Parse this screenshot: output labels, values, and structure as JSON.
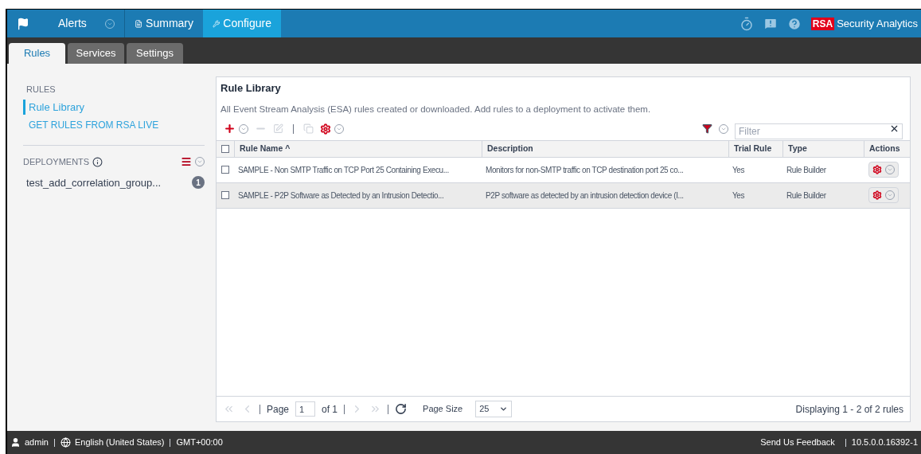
{
  "top_nav": {
    "items": [
      {
        "kind": "flag",
        "selected": false
      },
      {
        "kind": "dropdown",
        "label": "Alerts",
        "selected": false
      },
      {
        "kind": "summary",
        "label": "Summary",
        "selected": false
      },
      {
        "kind": "configure",
        "label": "Configure",
        "selected": true
      }
    ],
    "brand": {
      "logo": "RSA",
      "name": "Security Analytics"
    }
  },
  "sub_tabs": [
    {
      "label": "Rules",
      "selected": true
    },
    {
      "label": "Services",
      "selected": false
    },
    {
      "label": "Settings",
      "selected": false
    }
  ],
  "sidebar": {
    "heading": "RULES",
    "items": [
      {
        "label": "Rule Library",
        "selected": true
      },
      {
        "label": "GET RULES FROM RSA LIVE",
        "selected": false
      }
    ],
    "deployments": {
      "heading": "DEPLOYMENTS",
      "items": [
        {
          "name": "test_add_correlation_group...",
          "count": "1"
        }
      ]
    }
  },
  "panel": {
    "title": "Rule Library",
    "description": "All Event Stream Analysis (ESA) rules created or downloaded. Add rules to a deployment to activate them.",
    "toolbar": [
      {
        "kind": "add",
        "disabled": false
      },
      {
        "kind": "remove",
        "disabled": true
      },
      {
        "kind": "edit",
        "disabled": true
      },
      {
        "kind": "separator"
      },
      {
        "kind": "copy",
        "disabled": true
      },
      {
        "kind": "gear",
        "disabled": false
      }
    ],
    "filter": {
      "placeholder": "Filter"
    },
    "table": {
      "select_all_checked": false,
      "columns": [
        "Rule Name ^",
        "Description",
        "Trial Rule",
        "Type",
        "Actions"
      ],
      "rows": [
        {
          "checked": false,
          "selected": false,
          "cells": [
            "SAMPLE - Non SMTP Traffic on TCP Port 25 Containing Execu...",
            "Monitors for non-SMTP traffic on TCP destination port 25 co...",
            "Yes",
            "Rule Builder"
          ]
        },
        {
          "checked": false,
          "selected": true,
          "cells": [
            "SAMPLE - P2P Software as Detected by an Intrusion Detectio...",
            "P2P software as detected by an intrusion detection device (I...",
            "Yes",
            "Rule Builder"
          ]
        }
      ]
    },
    "pager": {
      "page_label": "Page",
      "page": "1",
      "of": "of 1",
      "size_label": "Page Size",
      "size": "25",
      "status": "Displaying 1 - 2 of 2 rules"
    }
  },
  "footer": {
    "user": "admin",
    "language": "English (United States)",
    "timezone": "GMT+00:00",
    "feedback": "Send Us Feedback",
    "version": "10.5.0.0.16392-1"
  }
}
